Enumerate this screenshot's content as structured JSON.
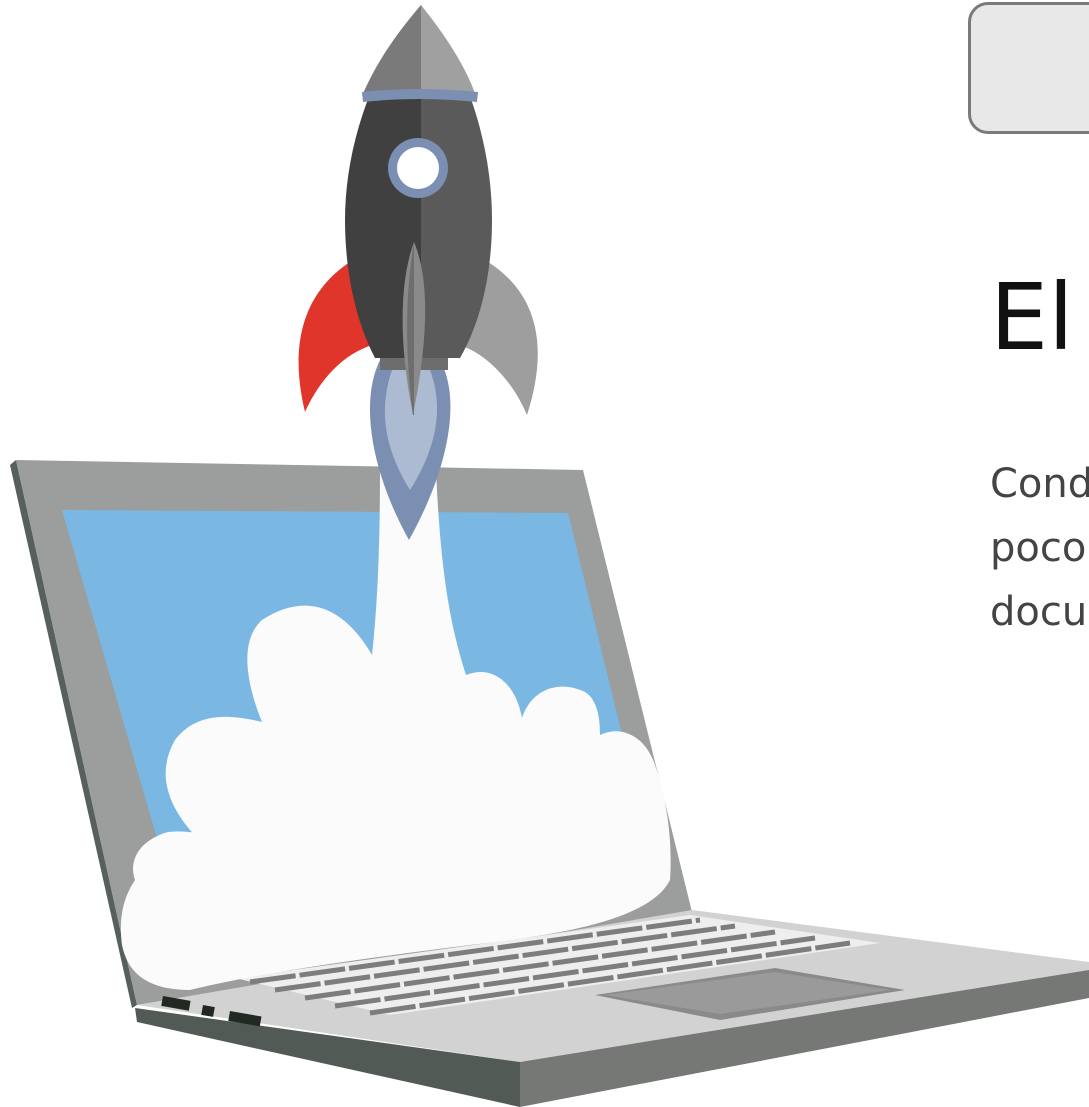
{
  "header": {
    "action_button_label": ""
  },
  "main": {
    "title": "El",
    "paragraph_lines": [
      "Cond",
      "poco",
      "docu"
    ]
  },
  "illustration": {
    "icons": [
      "laptop-icon",
      "rocket-icon",
      "smoke-cloud-icon"
    ],
    "colors": {
      "screen": "#7ab8e3",
      "rocket_body_dark": "#404040",
      "rocket_body_light": "#5a5a5a",
      "rocket_fin_red": "#e0352a",
      "rocket_fin_gray": "#9e9e9e",
      "rocket_trim_blue": "#7b8fb3",
      "cloud": "#fbfbfb",
      "laptop_bezel": "#9b9e9c",
      "laptop_base": "#d2d2d2"
    }
  }
}
